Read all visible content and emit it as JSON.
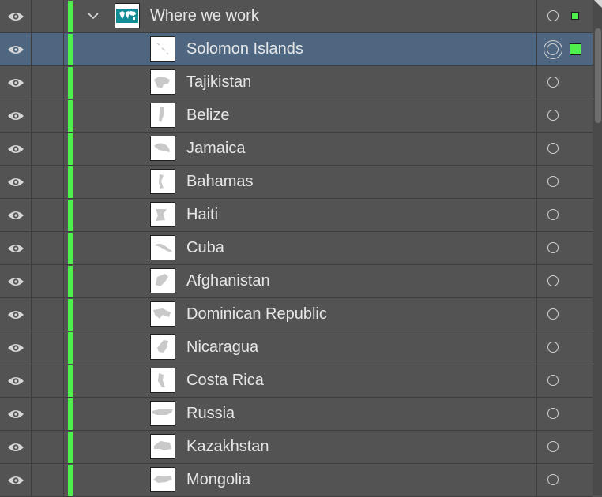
{
  "layers_panel": {
    "group": {
      "name": "Where we work",
      "expanded": true,
      "icon": "world-map-thumbnail"
    },
    "layers": [
      {
        "name": "Solomon Islands",
        "selected": true
      },
      {
        "name": "Tajikistan",
        "selected": false
      },
      {
        "name": "Belize",
        "selected": false
      },
      {
        "name": "Jamaica",
        "selected": false
      },
      {
        "name": "Bahamas",
        "selected": false
      },
      {
        "name": "Haiti",
        "selected": false
      },
      {
        "name": "Cuba",
        "selected": false
      },
      {
        "name": "Afghanistan",
        "selected": false
      },
      {
        "name": "Dominican Republic",
        "selected": false
      },
      {
        "name": "Nicaragua",
        "selected": false
      },
      {
        "name": "Costa Rica",
        "selected": false
      },
      {
        "name": "Russia",
        "selected": false
      },
      {
        "name": "Kazakhstan",
        "selected": false
      },
      {
        "name": "Mongolia",
        "selected": false
      }
    ],
    "colors": {
      "layer_color": "#4ef04e",
      "selected_row": "#4f6680",
      "panel_bg": "#535353"
    },
    "icons": {
      "visibility": "eye-icon",
      "expand": "chevron-down-icon",
      "target": "target-circle-icon"
    }
  }
}
